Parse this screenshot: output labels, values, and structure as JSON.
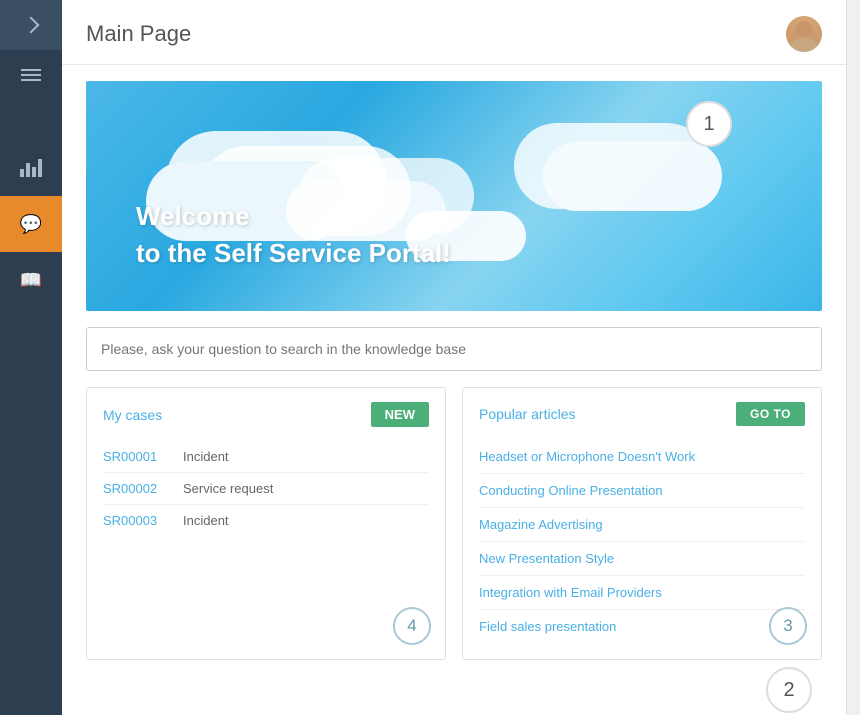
{
  "header": {
    "title": "Main Page"
  },
  "sidebar": {
    "items": [
      {
        "id": "expand",
        "label": "Expand sidebar",
        "icon": "chevron-right-icon"
      },
      {
        "id": "menu",
        "label": "Menu",
        "icon": "hamburger-icon"
      },
      {
        "id": "charts",
        "label": "Charts",
        "icon": "bar-chart-icon"
      },
      {
        "id": "chat",
        "label": "Chat",
        "icon": "chat-icon",
        "active": true
      },
      {
        "id": "knowledge",
        "label": "Knowledge",
        "icon": "book-icon"
      }
    ]
  },
  "hero": {
    "welcome_line1": "Welcome",
    "welcome_line2": "to the Self Service Portal!",
    "badge": "1"
  },
  "search": {
    "placeholder": "Please, ask your question to search in the knowledge base",
    "badge": "2"
  },
  "my_cases": {
    "title": "My cases",
    "new_button": "NEW",
    "badge": "4",
    "cases": [
      {
        "id": "SR00001",
        "type": "Incident"
      },
      {
        "id": "SR00002",
        "type": "Service request"
      },
      {
        "id": "SR00003",
        "type": "Incident"
      }
    ]
  },
  "popular_articles": {
    "title": "Popular articles",
    "goto_button": "GO TO",
    "badge": "3",
    "articles": [
      {
        "title": "Headset or Microphone Doesn't Work"
      },
      {
        "title": "Conducting Online Presentation"
      },
      {
        "title": "Magazine Advertising"
      },
      {
        "title": "New Presentation Style"
      },
      {
        "title": "Integration with Email Providers"
      },
      {
        "title": "Field sales presentation"
      }
    ]
  }
}
